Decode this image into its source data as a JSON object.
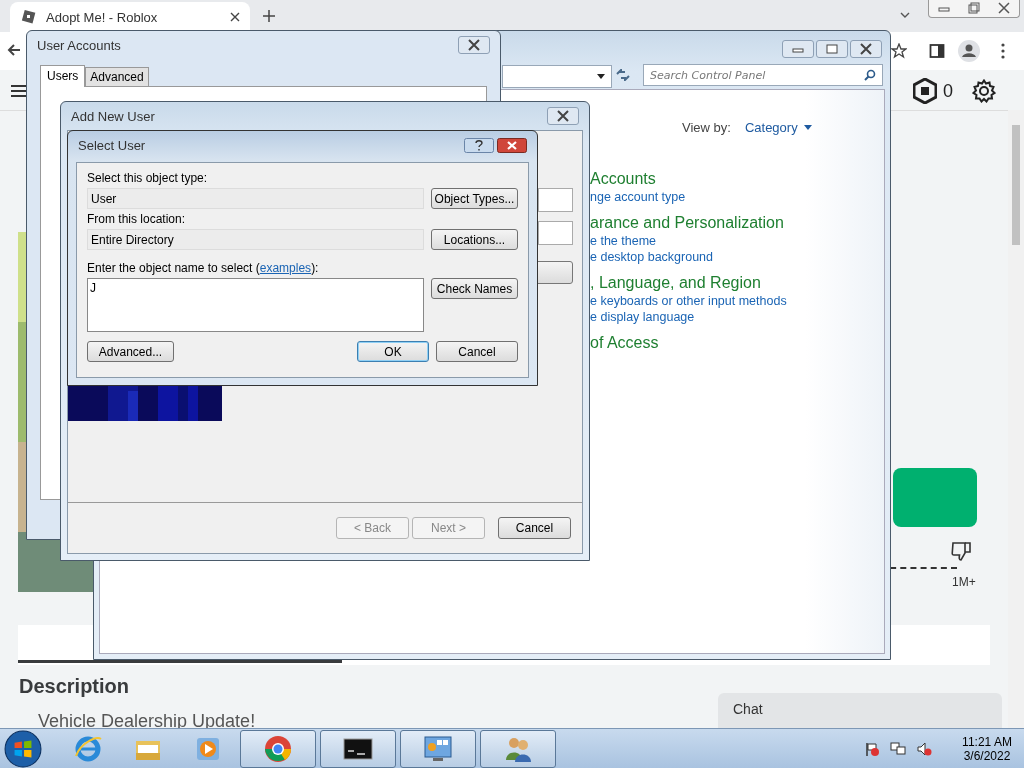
{
  "browser": {
    "tab_title": "Adopt Me! - Roblox",
    "robux": "0"
  },
  "roblox_page": {
    "stat": "1M+",
    "description_heading": "Description",
    "description_text": "Vehicle Dealership Update!",
    "chat_label": "Chat"
  },
  "control_panel": {
    "search_placeholder": "Search Control Panel",
    "view_by_label": "View by:",
    "view_by_value": "Category",
    "categories": [
      {
        "title": "Accounts",
        "links": [
          "nge account type"
        ]
      },
      {
        "title": "arance and Personalization",
        "links": [
          "e the theme",
          "e desktop background"
        ]
      },
      {
        "title": ", Language, and Region",
        "links": [
          "e keyboards or other input methods",
          "e display language"
        ]
      },
      {
        "title": "of Access"
      }
    ]
  },
  "user_accounts": {
    "title": "User Accounts",
    "tabs": [
      {
        "label": "Users",
        "selected": true
      },
      {
        "label": "Advanced",
        "selected": false
      }
    ]
  },
  "add_new_user": {
    "title": "Add New User",
    "buttons": [
      {
        "label": "< Back",
        "disabled": true
      },
      {
        "label": "Next >",
        "disabled": true
      },
      {
        "label": "Cancel",
        "disabled": false
      }
    ]
  },
  "select_user": {
    "title": "Select User",
    "object_type_label": "Select this object type:",
    "object_type": "User",
    "object_types_button": "Object Types...",
    "location_label": "From this location:",
    "location": "Entire Directory",
    "locations_button": "Locations...",
    "name_label": "Enter the object name to select (",
    "name_link": "examples",
    "name_label_end": "):",
    "name_value": "J",
    "check_names_button": "Check Names",
    "advanced_button": "Advanced...",
    "ok_button": "OK",
    "cancel_button": "Cancel"
  },
  "taskbar": {
    "apps": [
      {
        "kind": "ie",
        "open": false
      },
      {
        "kind": "explorer",
        "open": false
      },
      {
        "kind": "media",
        "open": false
      },
      {
        "kind": "chrome",
        "open": true
      },
      {
        "kind": "cmd",
        "open": true
      },
      {
        "kind": "control",
        "open": true
      },
      {
        "kind": "users",
        "open": true
      }
    ],
    "time": "11:21 AM",
    "date": "3/6/2022"
  }
}
